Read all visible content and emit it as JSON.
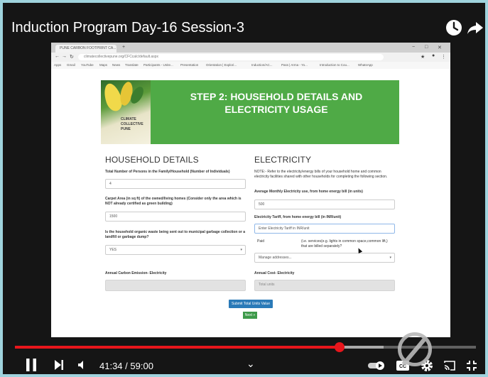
{
  "video": {
    "title": "Induction Program Day-16 Session-3",
    "time_current": "41:34",
    "time_total": "59:00",
    "time_separator": "/",
    "progress_fraction": 0.7046,
    "buffer_fraction": 0.8
  },
  "browser": {
    "tab_title": "PUNE CARBON FOOTPRINT CA...",
    "address": "climatecollectivepune.org/CFCcalc/default.aspx",
    "bookmarks": [
      "Apps",
      "Gmail",
      "YouTube",
      "Maps",
      "News",
      "Translate",
      "Participants - Unite...",
      "Presentation",
      "Orientation | Explori...",
      "Induction/AC...",
      "Pass | Arma - Yo...",
      "Introduction to Cou...",
      "WhatsApp"
    ]
  },
  "form": {
    "banner_title": "STEP 2: HOUSEHOLD DETAILS AND ELECTRICITY USAGE",
    "logo_lines": [
      "CLIMATE",
      "COLLECTIVE",
      "PUNE"
    ],
    "household": {
      "heading": "HOUSEHOLD DETAILS",
      "persons_label": "Total Number of Persons in the Family/Household (Number of Individuals)",
      "persons_value": "4",
      "area_label": "Carpet Area (in sq ft) of the owned/living homes (Consider only the area which is NOT already certified as green building)",
      "area_value": "1500",
      "waste_label": "Is the household organic waste being sent out to municipal garbage collection or a landfill or garbage dump?",
      "waste_value": "YES",
      "carbon_label": "Annual Carbon Emission- Electricity"
    },
    "electricity": {
      "heading": "ELECTRICITY",
      "note": "NOTE:- Refer to the electricity/energy bills of your household home and common electricity facilities shared with other households for completing the following section.",
      "usage_label": "Average Monthly Electricity use, from home energy bill (in units)",
      "usage_value": "500",
      "tariff_label": "Electricity Tariff, from home energy bill (in INR/unit)",
      "tariff_placeholder": "Enter Electricity Tariff in INR/unit",
      "paid_label": "Paid",
      "common_label": "(i.e. services(e.g. lights in common space,common lift,) that are billed separately?",
      "manage_placeholder": "Manage addresses...",
      "cost_label": "Annual Cost- Electricity",
      "cost_value": "Total units"
    },
    "submit_label": "Submit Total Units Value",
    "next_label": "Next »"
  },
  "colors": {
    "banner": "#4faa46",
    "progress": "#e8161c",
    "submit_button": "#2a7ab8",
    "next_button": "#3e9a4a"
  }
}
